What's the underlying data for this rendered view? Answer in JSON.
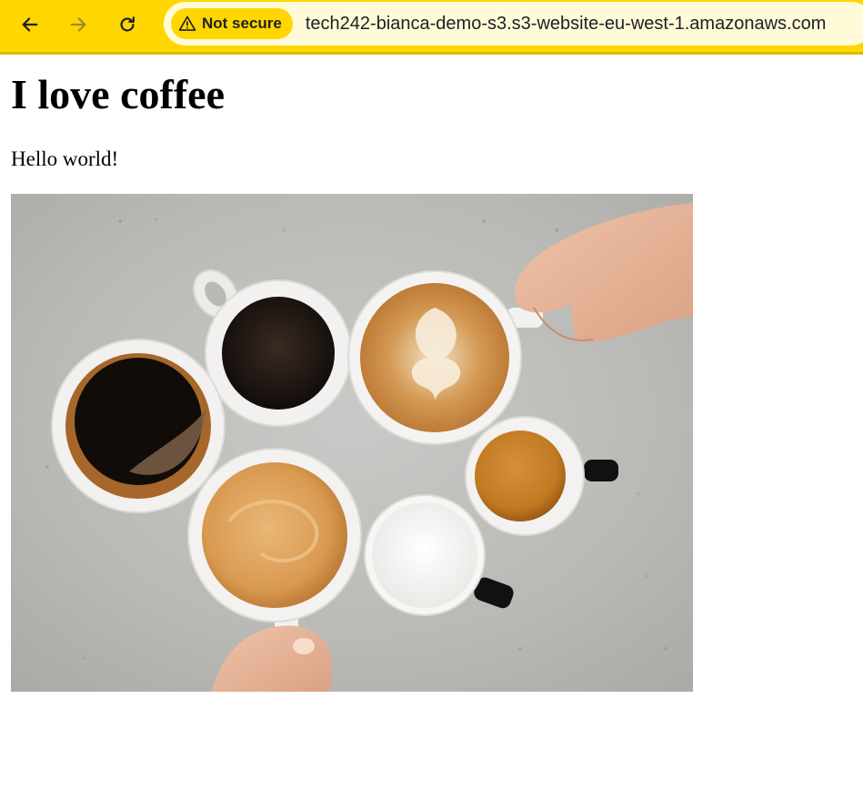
{
  "browser": {
    "back_icon": "arrow-left-icon",
    "forward_icon": "arrow-right-icon",
    "reload_icon": "reload-icon",
    "security": {
      "icon": "warning-triangle-icon",
      "label": "Not secure"
    },
    "url": "tech242-bianca-demo-s3.s3-website-eu-west-1.amazonaws.com",
    "toolbar_color": "#ffd600",
    "omnibox_color": "#fffbd8"
  },
  "page": {
    "heading": "I love coffee",
    "paragraph": "Hello world!",
    "image": {
      "subject": "coffee-cups-photo"
    }
  }
}
